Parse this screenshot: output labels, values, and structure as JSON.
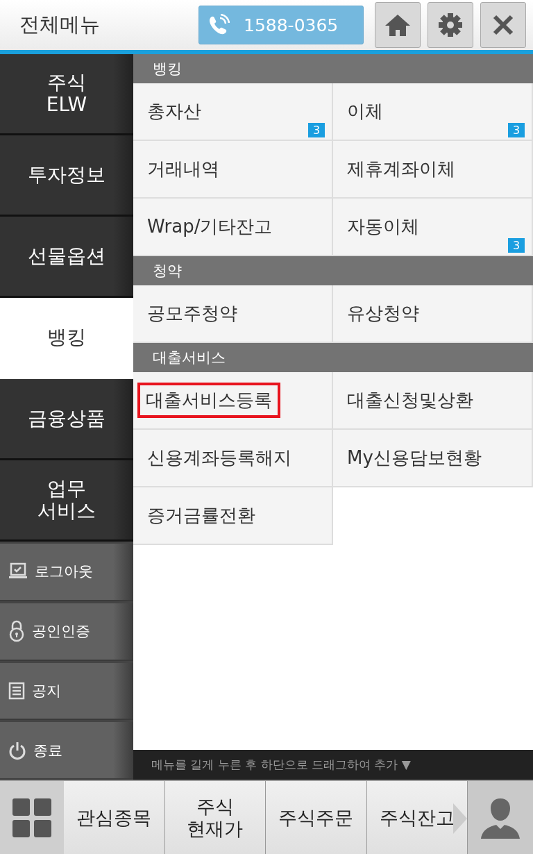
{
  "header": {
    "title": "전체메뉴",
    "phone": "1588-0365"
  },
  "categories": [
    {
      "label": "주식\nELW",
      "selected": false
    },
    {
      "label": "투자정보",
      "selected": false
    },
    {
      "label": "선물옵션",
      "selected": false
    },
    {
      "label": "뱅킹",
      "selected": true
    },
    {
      "label": "금융상품",
      "selected": false
    },
    {
      "label": "업무\n서비스",
      "selected": false
    }
  ],
  "utilities": [
    {
      "kind": "logout",
      "label": "로그아웃"
    },
    {
      "kind": "certificate",
      "label": "공인인증"
    },
    {
      "kind": "notice",
      "label": "공지"
    },
    {
      "kind": "exit",
      "label": "종료"
    }
  ],
  "sections": [
    {
      "title": "뱅킹",
      "items": [
        {
          "label": "총자산",
          "badge": "3",
          "highlighted": false
        },
        {
          "label": "이체",
          "badge": "3",
          "highlighted": false
        },
        {
          "label": "거래내역",
          "highlighted": false
        },
        {
          "label": "제휴계좌이체",
          "highlighted": false
        },
        {
          "label": "Wrap/기타잔고",
          "highlighted": false
        },
        {
          "label": "자동이체",
          "badge": "3",
          "highlighted": false
        }
      ]
    },
    {
      "title": "청약",
      "items": [
        {
          "label": "공모주청약",
          "highlighted": false
        },
        {
          "label": "유상청약",
          "highlighted": false
        }
      ]
    },
    {
      "title": "대출서비스",
      "items": [
        {
          "label": "대출서비스등록",
          "highlighted": true
        },
        {
          "label": "대출신청및상환",
          "highlighted": false
        },
        {
          "label": "신용계좌등록해지",
          "highlighted": false
        },
        {
          "label": "My신용담보현황",
          "highlighted": false
        },
        {
          "label": "증거금률전환",
          "highlighted": false
        }
      ]
    }
  ],
  "hint": "메뉴를 길게 누른 후 하단으로 드래그하여 추가 ▼",
  "shortcuts": [
    "관심종목",
    "주식\n현재가",
    "주식주문",
    "주식잔고"
  ]
}
